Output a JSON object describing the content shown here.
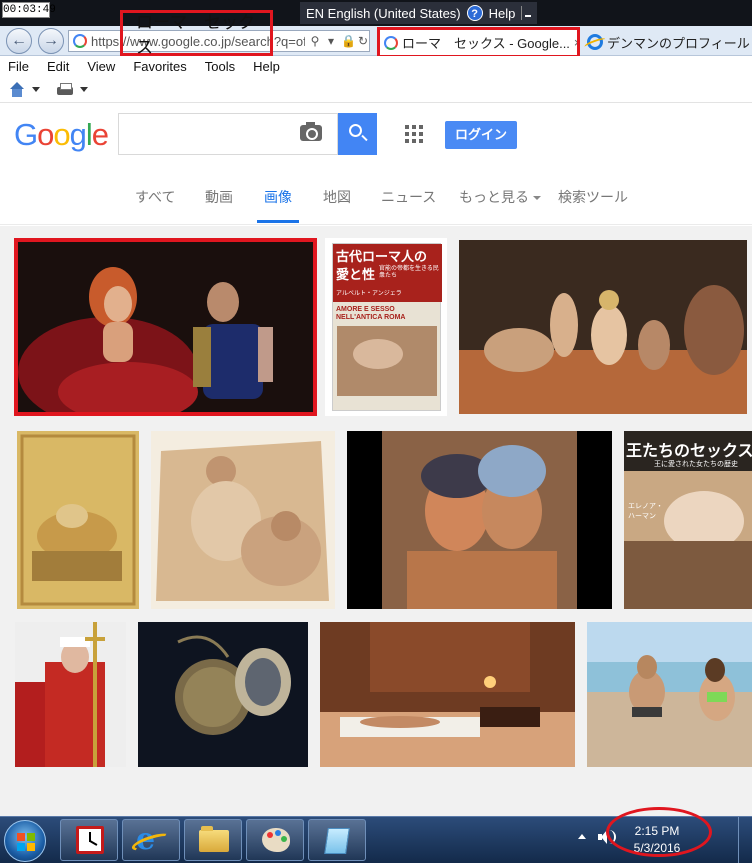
{
  "topbar": {
    "timer": "00:03:49",
    "language": "EN English (United States)",
    "help_label": "Help",
    "help_glyph": "?"
  },
  "browser": {
    "url": "https://www.google.co.jp/search?q=ofl",
    "active_tab_title": "ローマ　セックス - Google...",
    "second_tab_title": "デンマンのプロフィール De",
    "tab_close": "×"
  },
  "menu": [
    "File",
    "Edit",
    "View",
    "Favorites",
    "Tools",
    "Help"
  ],
  "google": {
    "logo_letters": [
      {
        "ch": "G",
        "color": "#4285F4"
      },
      {
        "ch": "o",
        "color": "#EA4335"
      },
      {
        "ch": "o",
        "color": "#FBBC05"
      },
      {
        "ch": "g",
        "color": "#4285F4"
      },
      {
        "ch": "l",
        "color": "#34A853"
      },
      {
        "ch": "e",
        "color": "#EA4335"
      }
    ],
    "query": "ローマ　セックス",
    "login_label": "ログイン",
    "tabs": [
      {
        "label": "すべて"
      },
      {
        "label": "動画"
      },
      {
        "label": "画像",
        "active": true
      },
      {
        "label": "地図"
      },
      {
        "label": "ニュース"
      },
      {
        "label": "もっと見る",
        "dropdown": true
      },
      {
        "label": "検索ツール"
      }
    ]
  },
  "results": {
    "book1": {
      "title_line1": "古代ローマ人の",
      "title_line2": "愛と性",
      "subtitle": "官能の帝都を生きる民衆たち",
      "author": "アルベルト・アンジェラ",
      "cover_text": "AMORE E SESSO NELL'ANTICA ROMA"
    },
    "book2": {
      "title": "王たちのセックス",
      "subtitle": "王に愛された女たちの歴史",
      "author": "エレノア・ハーマン"
    }
  },
  "taskbar": {
    "time": "2:15 PM",
    "date": "5/3/2016"
  }
}
